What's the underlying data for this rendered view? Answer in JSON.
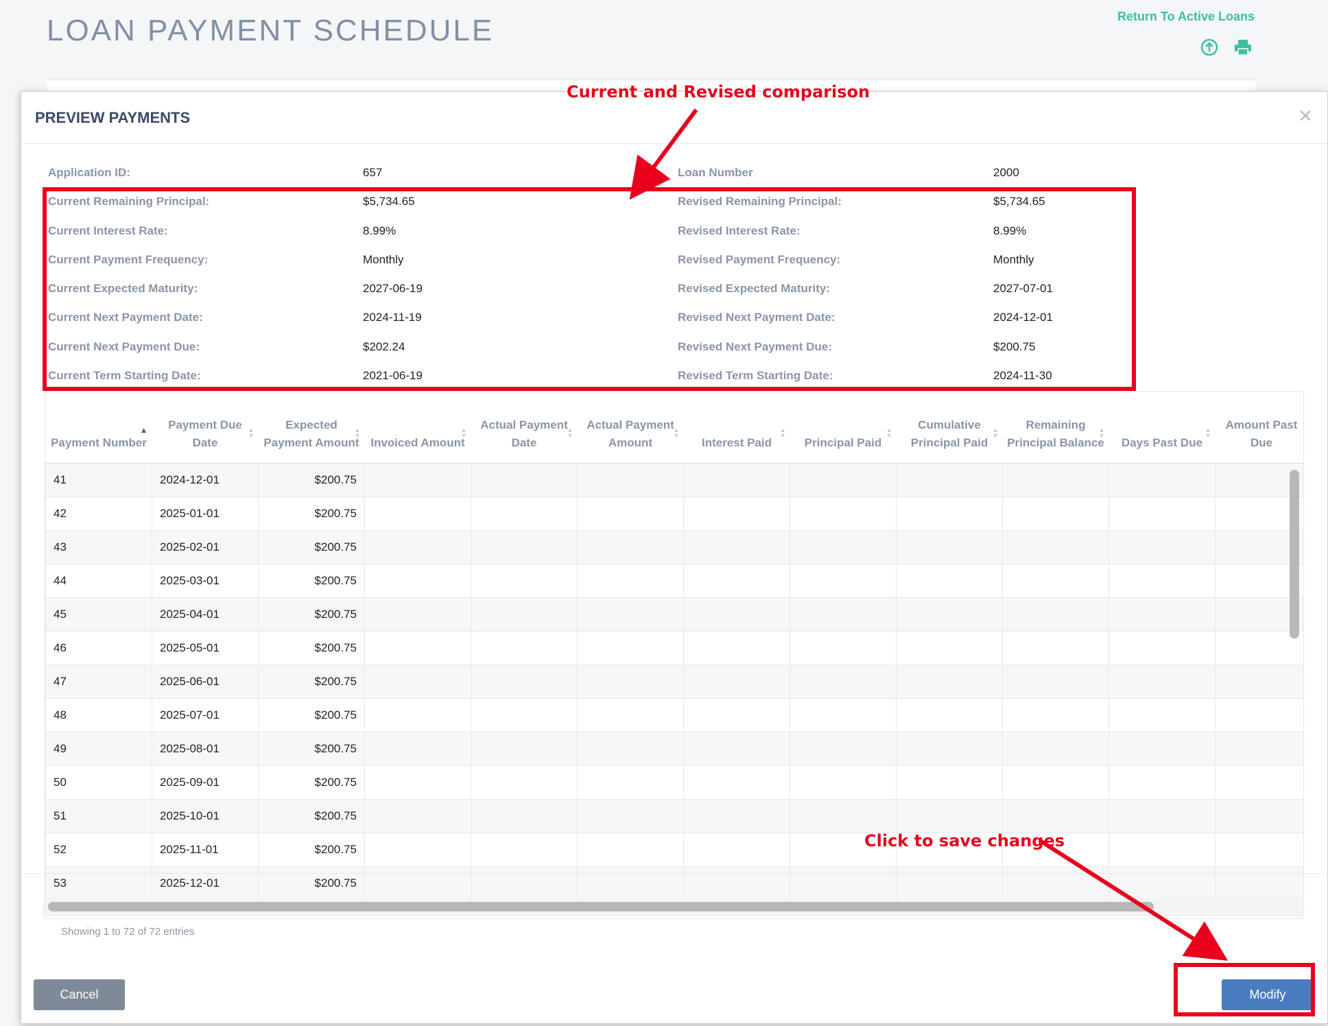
{
  "page": {
    "title": "LOAN PAYMENT SCHEDULE",
    "return_link": "Return To Active Loans"
  },
  "modal": {
    "title": "PREVIEW PAYMENTS",
    "close_glyph": "×",
    "info": [
      {
        "l1": "Application ID:",
        "v1": "657",
        "l2": "Loan Number",
        "v2": "2000"
      },
      {
        "l1": "Current Remaining Principal:",
        "v1": "$5,734.65",
        "l2": "Revised Remaining Principal:",
        "v2": "$5,734.65"
      },
      {
        "l1": "Current Interest Rate:",
        "v1": "8.99%",
        "l2": "Revised Interest Rate:",
        "v2": "8.99%"
      },
      {
        "l1": "Current Payment Frequency:",
        "v1": "Monthly",
        "l2": "Revised Payment Frequency:",
        "v2": "Monthly"
      },
      {
        "l1": "Current Expected Maturity:",
        "v1": "2027-06-19",
        "l2": "Revised Expected Maturity:",
        "v2": "2027-07-01"
      },
      {
        "l1": "Current Next Payment Date:",
        "v1": "2024-11-19",
        "l2": "Revised Next Payment Date:",
        "v2": "2024-12-01"
      },
      {
        "l1": "Current Next Payment Due:",
        "v1": "$202.24",
        "l2": "Revised Next Payment Due:",
        "v2": "$200.75"
      },
      {
        "l1": "Current Term Starting Date:",
        "v1": "2021-06-19",
        "l2": "Revised Term Starting Date:",
        "v2": "2024-11-30"
      }
    ],
    "table": {
      "columns": [
        "Payment Number",
        "Payment Due Date",
        "Expected Payment Amount",
        "Invoiced Amount",
        "Actual Payment Date",
        "Actual Payment Amount",
        "Interest Paid",
        "Principal Paid",
        "Cumulative Principal Paid",
        "Remaining Principal Balance",
        "Days Past Due",
        "Amount Past Due"
      ],
      "rows": [
        [
          "41",
          "2024-12-01",
          "$200.75"
        ],
        [
          "42",
          "2025-01-01",
          "$200.75"
        ],
        [
          "43",
          "2025-02-01",
          "$200.75"
        ],
        [
          "44",
          "2025-03-01",
          "$200.75"
        ],
        [
          "45",
          "2025-04-01",
          "$200.75"
        ],
        [
          "46",
          "2025-05-01",
          "$200.75"
        ],
        [
          "47",
          "2025-06-01",
          "$200.75"
        ],
        [
          "48",
          "2025-07-01",
          "$200.75"
        ],
        [
          "49",
          "2025-08-01",
          "$200.75"
        ],
        [
          "50",
          "2025-09-01",
          "$200.75"
        ],
        [
          "51",
          "2025-10-01",
          "$200.75"
        ],
        [
          "52",
          "2025-11-01",
          "$200.75"
        ],
        [
          "53",
          "2025-12-01",
          "$200.75"
        ]
      ],
      "entries_info": "Showing 1 to 72 of 72 entries"
    },
    "buttons": {
      "cancel": "Cancel",
      "modify": "Modify"
    }
  },
  "annotations": {
    "top": "Current and Revised comparison",
    "bottom": "Click to save changes",
    "color": "#e8001c"
  },
  "icons": [
    "upload-circle-icon",
    "printer-icon",
    "close-icon",
    "sort-icon"
  ]
}
